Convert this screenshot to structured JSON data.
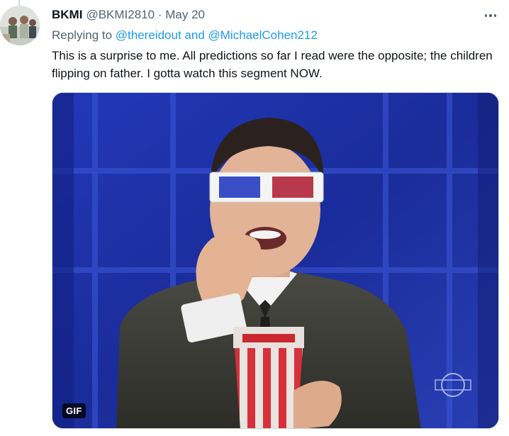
{
  "tweet": {
    "display_name": "BKMI",
    "handle": "@BKMI2810",
    "separator": "·",
    "date": "May 20",
    "replying_prefix": "Replying to",
    "replying_to": [
      "@thereidout",
      "@MichaelCohen212"
    ],
    "replying_joiner": "and",
    "text": "This is a surprise to me. All predictions so far I read were the opposite; the children flipping on father. I gotta watch this segment NOW.",
    "media": {
      "badge": "GIF"
    }
  },
  "icons": {
    "more": "more-horizontal-icon"
  },
  "colors": {
    "text": "#0f1419",
    "secondary": "#536471",
    "link": "#1d9bf0",
    "border": "#cfd9de"
  }
}
